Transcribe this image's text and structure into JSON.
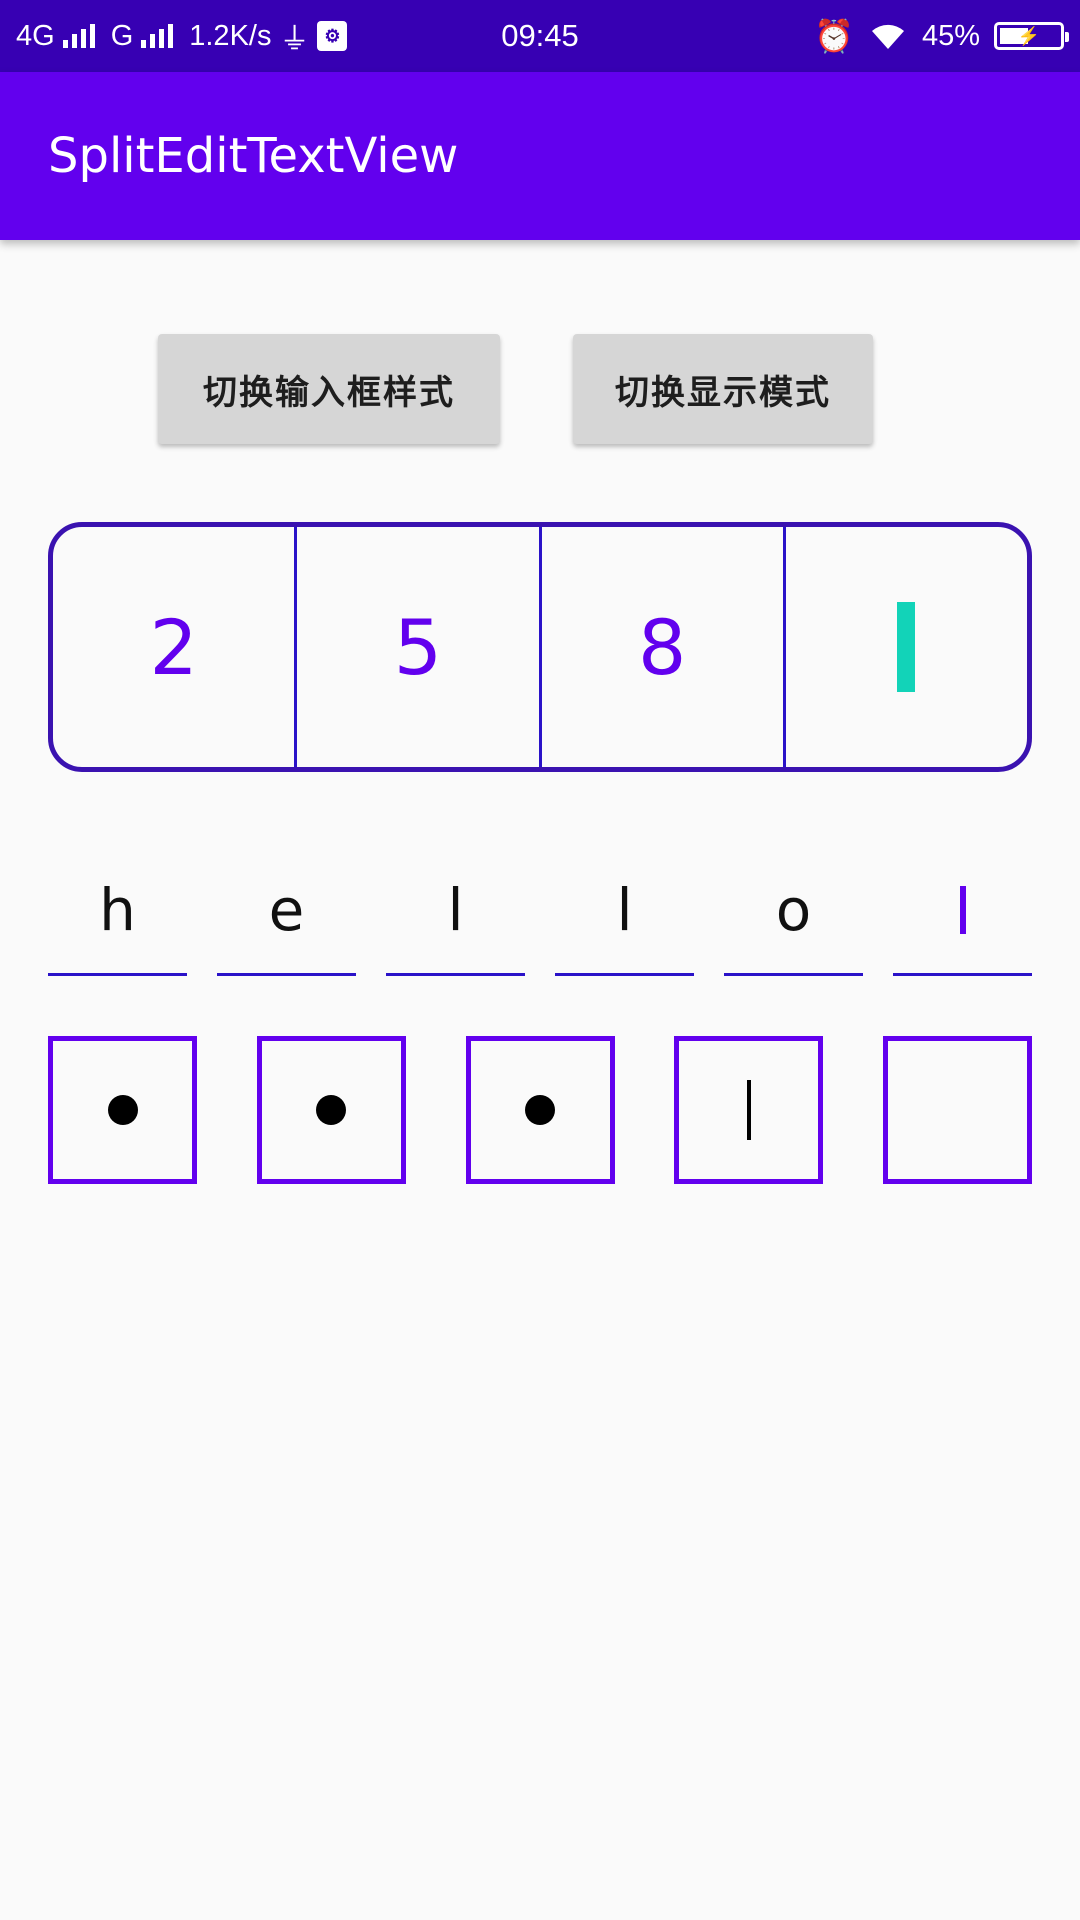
{
  "status_bar": {
    "network1": "4G",
    "network2": "G",
    "speed": "1.2K/s",
    "time": "09:45",
    "battery": "45%"
  },
  "app_bar": {
    "title": "SplitEditTextView"
  },
  "buttons": {
    "toggle_input_style": "切换输入框样式",
    "toggle_display_mode": "切换显示模式"
  },
  "split_box": {
    "digits": [
      "2",
      "5",
      "8",
      ""
    ]
  },
  "underline_input": {
    "chars": [
      "h",
      "e",
      "l",
      "l",
      "o",
      ""
    ]
  },
  "password_input": {
    "filled_count": 3,
    "total": 5
  },
  "colors": {
    "status_bar": "#3700b3",
    "app_bar": "#6200ee",
    "accent_teal": "#12d3b8",
    "border": "#3a12b0"
  }
}
